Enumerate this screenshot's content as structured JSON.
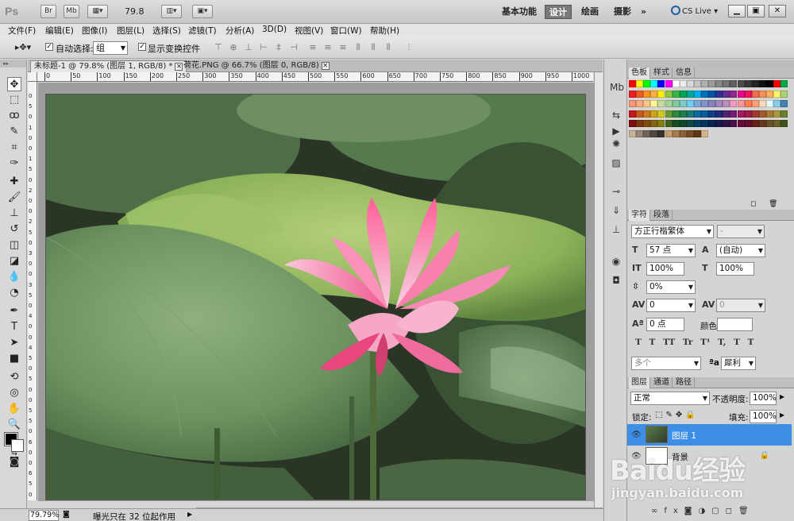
{
  "app": {
    "logo": "Ps",
    "titlebar_icons": [
      "Br",
      "Mb"
    ],
    "zoom_level": "79.8",
    "workspaces": [
      "基本功能",
      "设计",
      "绘画",
      "摄影"
    ],
    "active_workspace": "设计",
    "more": "»",
    "cs_live": "CS Live"
  },
  "menu": [
    "文件(F)",
    "编辑(E)",
    "图像(I)",
    "图层(L)",
    "选择(S)",
    "滤镜(T)",
    "分析(A)",
    "3D(D)",
    "视图(V)",
    "窗口(W)",
    "帮助(H)"
  ],
  "options": {
    "auto_select_label": "自动选择:",
    "auto_select_value": "组",
    "show_transform_label": "显示变换控件"
  },
  "tabs": [
    {
      "label": "未标题-1 @ 79.8% (图层 1, RGB/8) *",
      "active": true
    },
    {
      "label": "荷花.PNG @ 66.7% (图层 0, RGB/8)",
      "active": false
    }
  ],
  "ruler": {
    "top_labels": [
      "0",
      "50",
      "100",
      "150",
      "200",
      "250",
      "300",
      "350",
      "400",
      "450",
      "500",
      "550",
      "600",
      "650",
      "700",
      "750",
      "800",
      "850",
      "900",
      "950",
      "1000"
    ],
    "left_labels": [
      "0",
      "5",
      "0",
      "1",
      "0",
      "0",
      "1",
      "5",
      "0",
      "2",
      "0",
      "0",
      "2",
      "5",
      "0",
      "3",
      "0",
      "0",
      "3",
      "5",
      "0",
      "4",
      "0",
      "0",
      "4",
      "5",
      "0",
      "5",
      "0",
      "0",
      "5",
      "5",
      "0",
      "6",
      "0",
      "0",
      "6",
      "5",
      "0"
    ]
  },
  "status": {
    "zoom": "79.79%",
    "message": "曝光只在 32 位起作用"
  },
  "swatches_panel": {
    "tabs": [
      "色板",
      "样式",
      "信息"
    ]
  },
  "character_panel": {
    "tabs": [
      "字符",
      "段落"
    ],
    "font_family": "方正行楷繁体",
    "font_style": "-",
    "font_size": "57 点",
    "leading": "(自动)",
    "vertical_scale": "100%",
    "horizontal_scale": "100%",
    "tracking_ratio": "0%",
    "kerning": "0",
    "tracking": "0",
    "baseline_shift": "0 点",
    "color_label": "颜色:",
    "style_buttons": "T T TT Tr T¹ T, T T",
    "language": "多个",
    "aa_prefix": "ªa",
    "antialias": "犀利"
  },
  "layers_panel": {
    "tabs": [
      "图层",
      "通道",
      "路径"
    ],
    "blend_mode": "正常",
    "opacity_label": "不透明度:",
    "opacity": "100%",
    "lock_label": "锁定:",
    "fill_label": "填充:",
    "fill": "100%",
    "layers": [
      {
        "name": "图层 1",
        "selected": true
      },
      {
        "name": "背景",
        "selected": false
      }
    ]
  },
  "watermark": {
    "brand": "Baidu经验",
    "site": "jingyan.baidu.com"
  },
  "colors": {
    "accent": "#3d8ee6",
    "window_bg": "#d6d6d6"
  }
}
